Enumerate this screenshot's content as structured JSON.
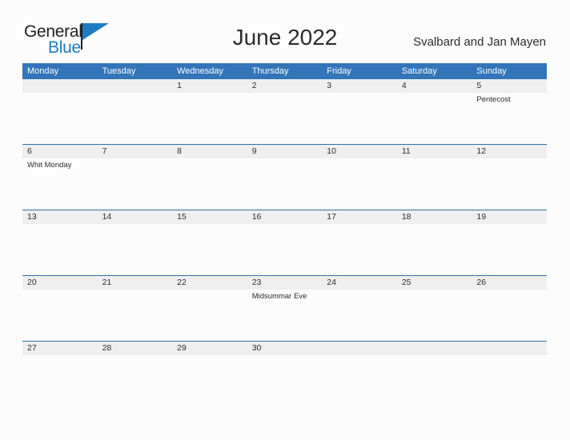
{
  "brand": {
    "name_part1": "General",
    "name_part2": "Blue",
    "color_dark": "#231f20",
    "color_blue": "#1f7bc1"
  },
  "header": {
    "month_title": "June 2022",
    "region": "Svalbard and Jan Mayen"
  },
  "calendar": {
    "header_color": "#3275b8",
    "band_color": "#efefef",
    "row_border_color": "#2f6fa8",
    "weekdays": [
      "Monday",
      "Tuesday",
      "Wednesday",
      "Thursday",
      "Friday",
      "Saturday",
      "Sunday"
    ],
    "weeks": [
      [
        {
          "day": "",
          "events": []
        },
        {
          "day": "",
          "events": []
        },
        {
          "day": "1",
          "events": []
        },
        {
          "day": "2",
          "events": []
        },
        {
          "day": "3",
          "events": []
        },
        {
          "day": "4",
          "events": []
        },
        {
          "day": "5",
          "events": [
            "Pentecost"
          ]
        }
      ],
      [
        {
          "day": "6",
          "events": [
            "Whit Monday"
          ]
        },
        {
          "day": "7",
          "events": []
        },
        {
          "day": "8",
          "events": []
        },
        {
          "day": "9",
          "events": []
        },
        {
          "day": "10",
          "events": []
        },
        {
          "day": "11",
          "events": []
        },
        {
          "day": "12",
          "events": []
        }
      ],
      [
        {
          "day": "13",
          "events": []
        },
        {
          "day": "14",
          "events": []
        },
        {
          "day": "15",
          "events": []
        },
        {
          "day": "16",
          "events": []
        },
        {
          "day": "17",
          "events": []
        },
        {
          "day": "18",
          "events": []
        },
        {
          "day": "19",
          "events": []
        }
      ],
      [
        {
          "day": "20",
          "events": []
        },
        {
          "day": "21",
          "events": []
        },
        {
          "day": "22",
          "events": []
        },
        {
          "day": "23",
          "events": [
            "Midsummar Eve"
          ]
        },
        {
          "day": "24",
          "events": []
        },
        {
          "day": "25",
          "events": []
        },
        {
          "day": "26",
          "events": []
        }
      ],
      [
        {
          "day": "27",
          "events": []
        },
        {
          "day": "28",
          "events": []
        },
        {
          "day": "29",
          "events": []
        },
        {
          "day": "30",
          "events": []
        },
        {
          "day": "",
          "events": []
        },
        {
          "day": "",
          "events": []
        },
        {
          "day": "",
          "events": []
        }
      ]
    ]
  }
}
